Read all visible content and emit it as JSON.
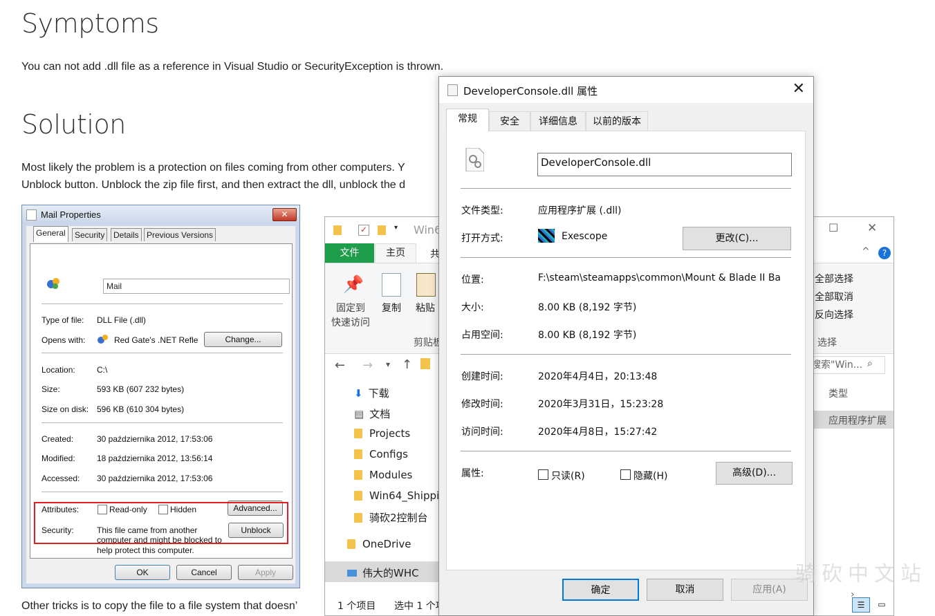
{
  "article": {
    "h_symptoms": "Symptoms",
    "p_symptoms": "You can not add .dll file as a reference in Visual Studio or SecurityException is thrown.",
    "h_solution": "Solution",
    "p_solution_1": "Most likely the problem is a protection on files coming from other computers. Y",
    "p_solution_2": "Unblock button. Unblock the zip file first, and then extract the dll, unblock the d",
    "p_other": "Other tricks is to copy the file to a file system that doesn’"
  },
  "mail_dialog": {
    "title": "Mail Properties",
    "close": "✕",
    "tabs": [
      "General",
      "Security",
      "Details",
      "Previous Versions"
    ],
    "name_value": "Mail",
    "type_label": "Type of file:",
    "type_value": "DLL File (.dll)",
    "opens_label": "Opens with:",
    "opens_value": "Red Gate's .NET Refle",
    "change_button": "Change...",
    "location_label": "Location:",
    "location_value": "C:\\",
    "size_label": "Size:",
    "size_value": "593 KB (607 232 bytes)",
    "size_disk_label": "Size on disk:",
    "size_disk_value": "596 KB (610 304 bytes)",
    "created_label": "Created:",
    "created_value": "30 października 2012, 17:53:06",
    "modified_label": "Modified:",
    "modified_value": "18 października 2012, 13:56:14",
    "accessed_label": "Accessed:",
    "accessed_value": "30 października 2012, 17:53:06",
    "attributes_label": "Attributes:",
    "readonly_label": "Read-only",
    "hidden_label": "Hidden",
    "advanced_button": "Advanced...",
    "security_label": "Security:",
    "security_text_1": "This file came from another",
    "security_text_2": "computer and might be blocked to",
    "security_text_3": "help protect this computer.",
    "unblock_button": "Unblock",
    "ok_button": "OK",
    "cancel_button": "Cancel",
    "apply_button": "Apply"
  },
  "explorer": {
    "title_partial": "Win6",
    "tab_file": "文件",
    "tab_home": "主页",
    "tab_share_partial": "共",
    "pin_label_1": "固定到",
    "pin_label_2": "快速访问",
    "copy_label": "复制",
    "paste_label": "粘贴",
    "clipboard_group_partial": "剪贴板",
    "select_all": "全部选择",
    "select_none": "全部取消",
    "invert_select": "反向选择",
    "select_group": "选择",
    "search_placeholder": "搜索\"Win...",
    "col_type": "类型",
    "row_type": "应用程序扩展",
    "tree": [
      "下载",
      "文档",
      "Projects",
      "Configs",
      "Modules",
      "Win64_Shippi",
      "骑砍2控制台",
      "OneDrive",
      "伟大的WHC"
    ],
    "status_items": "1 个项目",
    "status_selected": "选中 1 个项"
  },
  "props_dialog": {
    "title": "DeveloperConsole.dll 属性",
    "close": "✕",
    "tabs": [
      "常规",
      "安全",
      "详细信息",
      "以前的版本"
    ],
    "filename": "DeveloperConsole.dll",
    "type_label": "文件类型:",
    "type_value": "应用程序扩展 (.dll)",
    "opens_label": "打开方式:",
    "opens_value": "Exescope",
    "change_button": "更改(C)...",
    "location_label": "位置:",
    "location_value": "F:\\steam\\steamapps\\common\\Mount & Blade II Ba",
    "size_label": "大小:",
    "size_value": "8.00 KB (8,192 字节)",
    "disk_label": "占用空间:",
    "disk_value": "8.00 KB (8,192 字节)",
    "created_label": "创建时间:",
    "created_value": "2020年4月4日，20:13:48",
    "modified_label": "修改时间:",
    "modified_value": "2020年3月31日，15:23:28",
    "accessed_label": "访问时间:",
    "accessed_value": "2020年4月8日，15:27:42",
    "attr_label": "属性:",
    "readonly_label": "只读(R)",
    "hidden_label": "隐藏(H)",
    "advanced_button": "高级(D)...",
    "ok_button": "确定",
    "cancel_button": "取消",
    "apply_button": "应用(A)"
  },
  "watermark": "骑砍中文站"
}
